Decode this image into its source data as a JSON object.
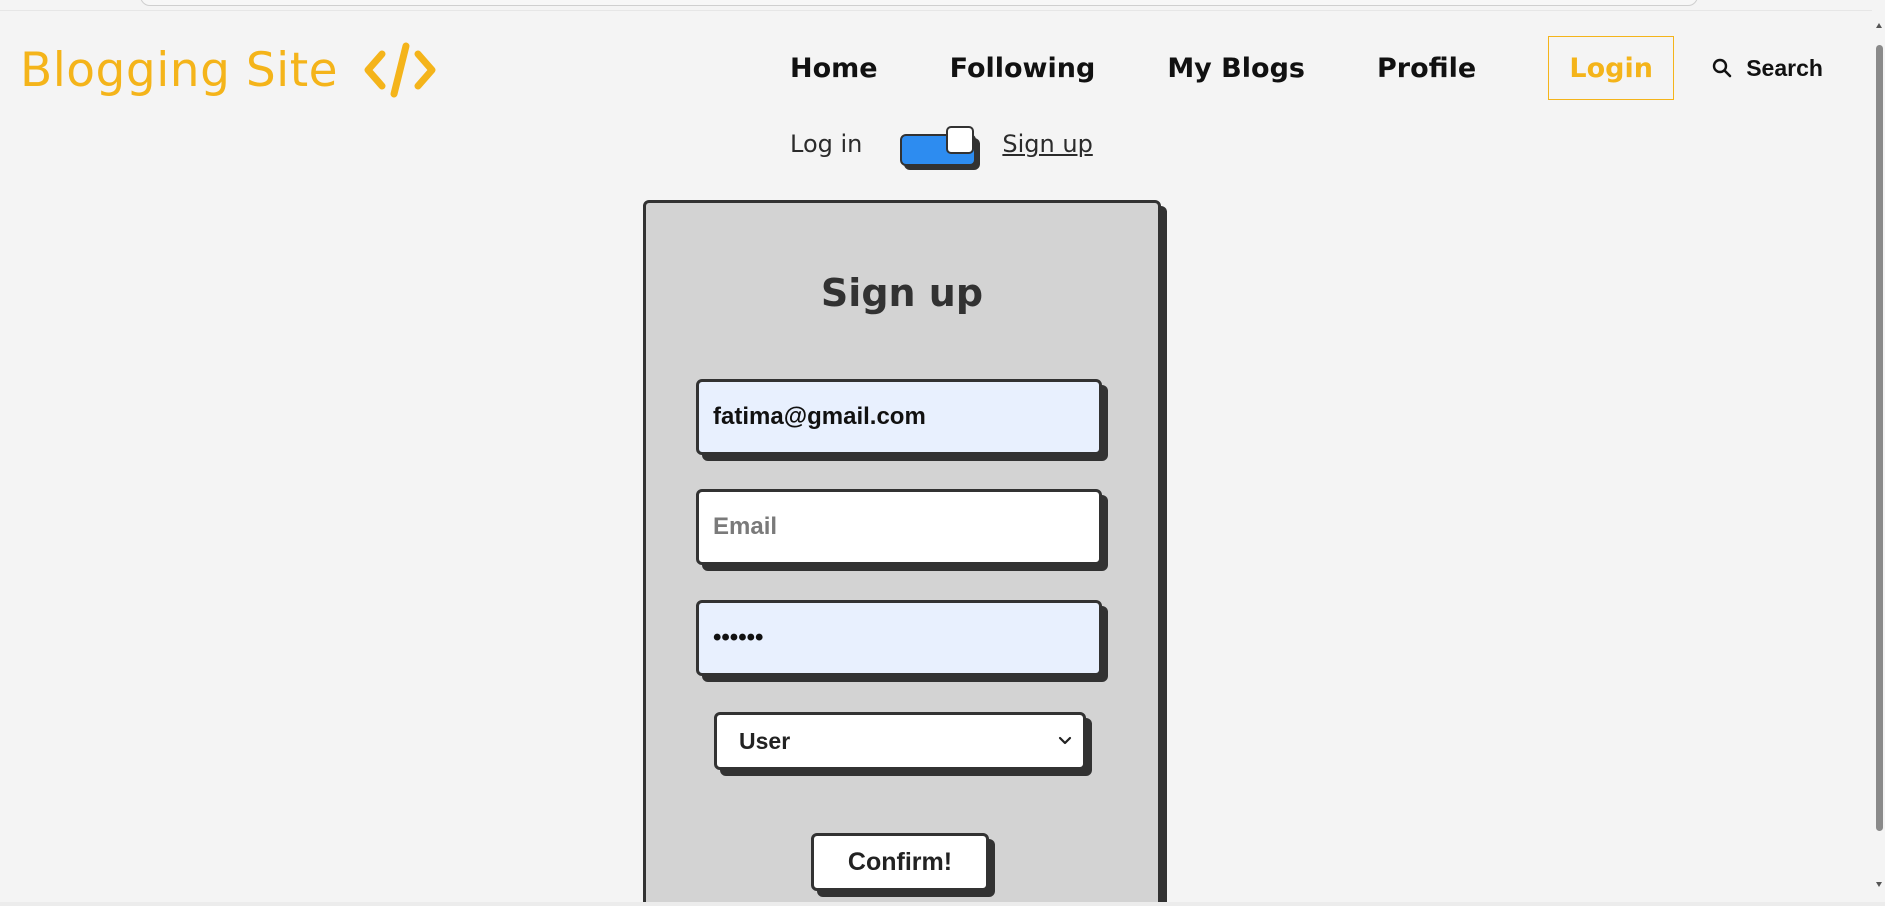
{
  "header": {
    "brand": "Blogging Site",
    "brand_icon": "code-icon",
    "brand_color": "#f4b41a",
    "nav": {
      "home": "Home",
      "following": "Following",
      "my_blogs": "My Blogs",
      "profile": "Profile",
      "login": "Login",
      "search": "Search"
    }
  },
  "auth_toggle": {
    "left_label": "Log in",
    "right_label": "Sign up",
    "active": "Sign up",
    "track_color": "#2d8cf0"
  },
  "form": {
    "title": "Sign up",
    "username_value": "fatima@gmail.com",
    "email_placeholder": "Email",
    "password_masked": "••••••",
    "role_selected": "User",
    "confirm_label": "Confirm!"
  }
}
